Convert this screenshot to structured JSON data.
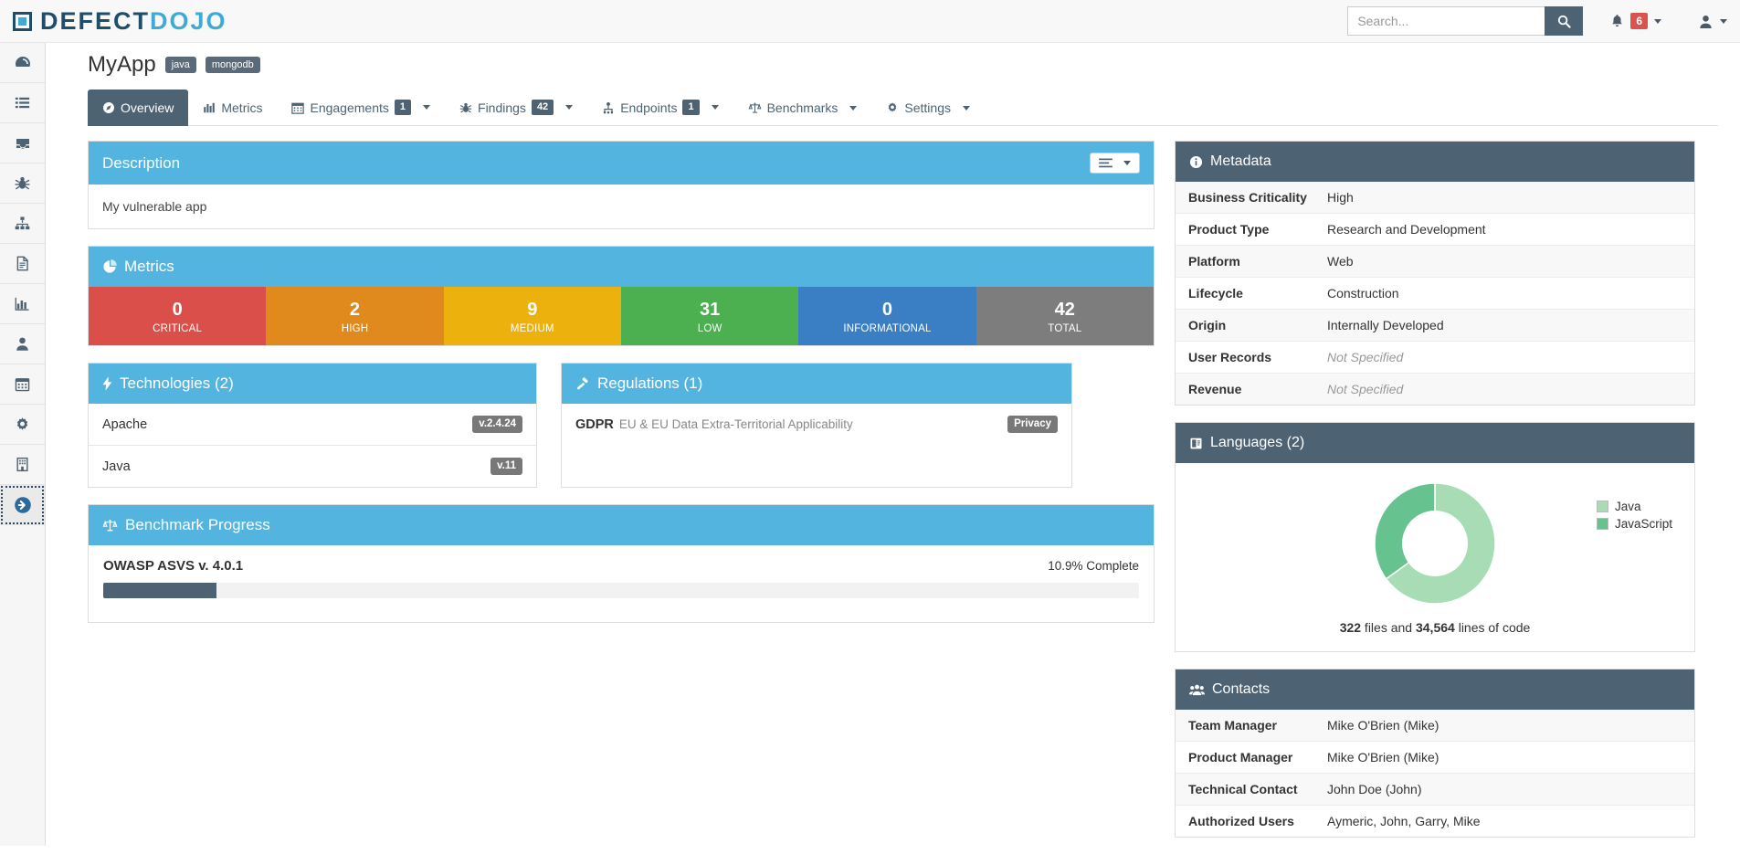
{
  "topbar": {
    "logo_defect": "DEFECT",
    "logo_dojo": "DOJO",
    "search_placeholder": "Search...",
    "search_value": "",
    "notification_count": "6"
  },
  "sidebar": {
    "items": [
      {
        "icon": "dashboard-icon",
        "name": "sidebar-item-dashboard"
      },
      {
        "icon": "list-icon",
        "name": "sidebar-item-list"
      },
      {
        "icon": "inbox-icon",
        "name": "sidebar-item-inbox"
      },
      {
        "icon": "bug-icon",
        "name": "sidebar-item-findings"
      },
      {
        "icon": "sitemap-icon",
        "name": "sidebar-item-sitemap"
      },
      {
        "icon": "document-icon",
        "name": "sidebar-item-reports"
      },
      {
        "icon": "bar-chart-icon",
        "name": "sidebar-item-metrics"
      },
      {
        "icon": "user-icon",
        "name": "sidebar-item-users"
      },
      {
        "icon": "calendar-icon",
        "name": "sidebar-item-calendar"
      },
      {
        "icon": "gear-icon",
        "name": "sidebar-item-settings"
      },
      {
        "icon": "building-icon",
        "name": "sidebar-item-organization"
      },
      {
        "icon": "arrow-circle-right-icon",
        "name": "sidebar-item-expand",
        "active": true
      }
    ]
  },
  "page": {
    "title": "MyApp",
    "tags": [
      "java",
      "mongodb"
    ]
  },
  "tabs": [
    {
      "label": "Overview",
      "icon": "compass-icon",
      "badge": "",
      "caret": false,
      "active": true
    },
    {
      "label": "Metrics",
      "icon": "bar-chart-icon",
      "badge": "",
      "caret": false,
      "active": false
    },
    {
      "label": "Engagements",
      "icon": "calendar-icon",
      "badge": "1",
      "caret": true,
      "active": false
    },
    {
      "label": "Findings",
      "icon": "bug-icon",
      "badge": "42",
      "caret": true,
      "active": false
    },
    {
      "label": "Endpoints",
      "icon": "endpoint-icon",
      "badge": "1",
      "caret": true,
      "active": false
    },
    {
      "label": "Benchmarks",
      "icon": "scales-icon",
      "badge": "",
      "caret": true,
      "active": false
    },
    {
      "label": "Settings",
      "icon": "gear-icon",
      "badge": "",
      "caret": true,
      "active": false
    }
  ],
  "description": {
    "title": "Description",
    "text": "My vulnerable app",
    "menu_icon": "hamburger-icon"
  },
  "metrics": {
    "title": "Metrics",
    "icon": "pie-chart-icon",
    "severities": [
      {
        "label": "CRITICAL",
        "count": "0",
        "color": "#da4f49"
      },
      {
        "label": "HIGH",
        "count": "2",
        "color": "#e08a1e"
      },
      {
        "label": "MEDIUM",
        "count": "9",
        "color": "#edb10e"
      },
      {
        "label": "LOW",
        "count": "31",
        "color": "#4caf50"
      },
      {
        "label": "INFORMATIONAL",
        "count": "0",
        "color": "#3a7fc4"
      },
      {
        "label": "TOTAL",
        "count": "42",
        "color": "#7d7d7d"
      }
    ]
  },
  "technologies": {
    "title": "Technologies (2)",
    "icon": "bolt-icon",
    "items": [
      {
        "name": "Apache",
        "version": "v.2.4.24"
      },
      {
        "name": "Java",
        "version": "v.11"
      }
    ]
  },
  "regulations": {
    "title": "Regulations (1)",
    "icon": "gavel-icon",
    "items": [
      {
        "code": "GDPR",
        "description": "EU & EU Data Extra-Territorial Applicability",
        "category": "Privacy"
      }
    ]
  },
  "benchmark": {
    "title": "Benchmark Progress",
    "icon": "scales-icon",
    "name": "OWASP ASVS v. 4.0.1",
    "percent_label": "10.9% Complete",
    "percent": 10.9
  },
  "metadata": {
    "title": "Metadata",
    "icon": "info-icon",
    "rows": [
      {
        "key": "Business Criticality",
        "value": "High",
        "muted": false
      },
      {
        "key": "Product Type",
        "value": "Research and Development",
        "muted": false
      },
      {
        "key": "Platform",
        "value": "Web",
        "muted": false
      },
      {
        "key": "Lifecycle",
        "value": "Construction",
        "muted": false
      },
      {
        "key": "Origin",
        "value": "Internally Developed",
        "muted": false
      },
      {
        "key": "User Records",
        "value": "Not Specified",
        "muted": true
      },
      {
        "key": "Revenue",
        "value": "Not Specified",
        "muted": true
      }
    ]
  },
  "languages": {
    "title": "Languages (2)",
    "icon": "code-book-icon",
    "files_count": "322",
    "files_word": " files and ",
    "lines_count": "34,564",
    "lines_word": " lines of code"
  },
  "chart_data": {
    "type": "pie",
    "title": "Languages (2)",
    "labels": [
      "Java",
      "JavaScript"
    ],
    "values": [
      65,
      35
    ],
    "colors": [
      "#a8dcb5",
      "#66c390"
    ],
    "legend_position": "right",
    "donut": true,
    "annotations": [
      "322 files and 34,564 lines of code"
    ]
  },
  "contacts": {
    "title": "Contacts",
    "icon": "users-icon",
    "rows": [
      {
        "key": "Team Manager",
        "value": "Mike O'Brien (Mike)"
      },
      {
        "key": "Product Manager",
        "value": "Mike O'Brien (Mike)"
      },
      {
        "key": "Technical Contact",
        "value": "John Doe (John)"
      },
      {
        "key": "Authorized Users",
        "value": "Aymeric, John, Garry, Mike"
      }
    ]
  }
}
